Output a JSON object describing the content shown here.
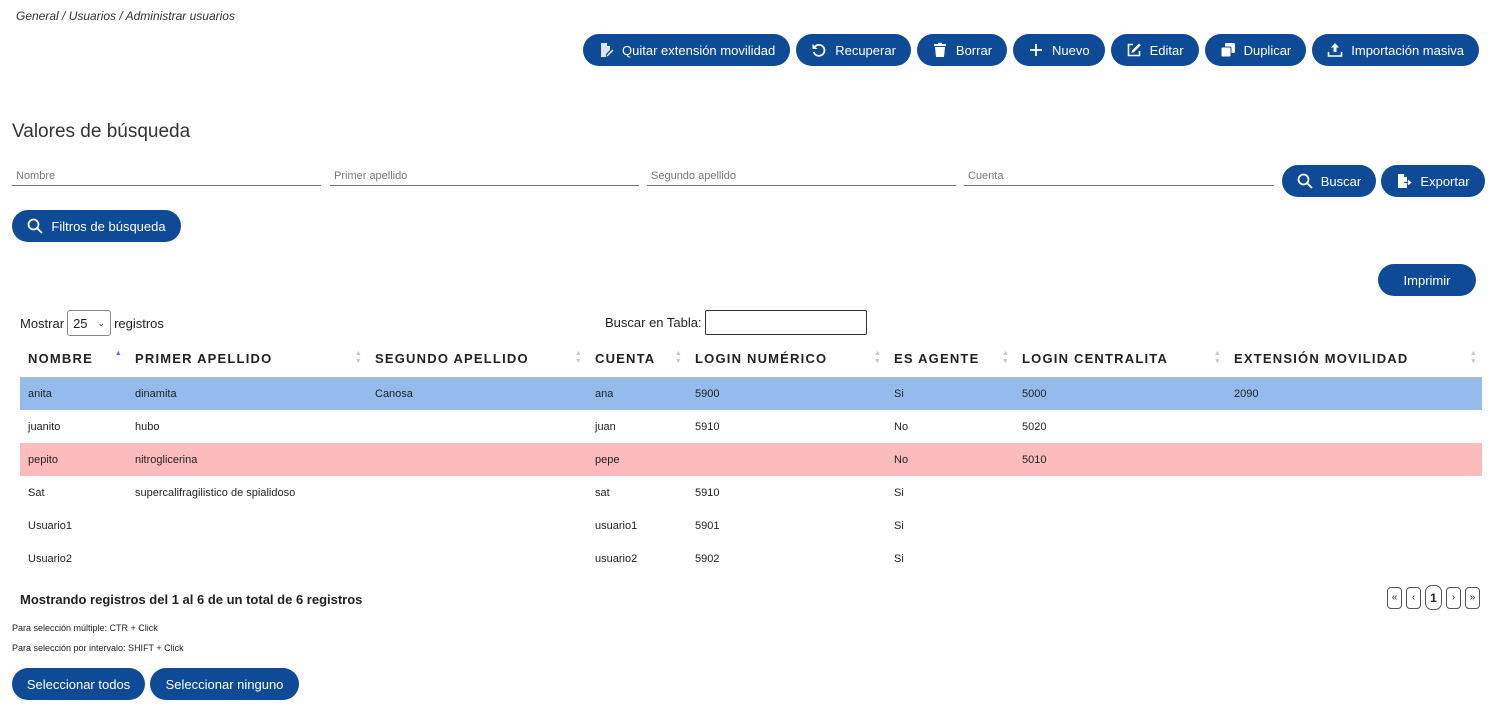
{
  "breadcrumb": "General / Usuarios / Administrar usuarios",
  "toolbar": {
    "quitar": "Quitar extensión movilidad",
    "recuperar": "Recuperar",
    "borrar": "Borrar",
    "nuevo": "Nuevo",
    "editar": "Editar",
    "duplicar": "Duplicar",
    "importacion": "Importación masiva"
  },
  "search": {
    "title": "Valores de búsqueda",
    "nombre_placeholder": "Nombre",
    "apellido1_placeholder": "Primer apellido",
    "apellido2_placeholder": "Segundo apellido",
    "cuenta_placeholder": "Cuenta",
    "buscar": "Buscar",
    "exportar": "Exportar",
    "filtros": "Filtros de búsqueda"
  },
  "imprimir": "Imprimir",
  "table_controls": {
    "mostrar": "Mostrar",
    "page_size": "25",
    "registros": "registros",
    "buscar_en_tabla": "Buscar en Tabla:"
  },
  "table": {
    "columns": [
      "NOMBRE",
      "PRIMER APELLIDO",
      "SEGUNDO APELLIDO",
      "CUENTA",
      "LOGIN NUMÉRICO",
      "ES AGENTE",
      "LOGIN CENTRALITA",
      "EXTENSIÓN MOVILIDAD"
    ],
    "rows": [
      [
        "anita",
        "dinamita",
        "Canosa",
        "ana",
        "5900",
        "Si",
        "5000",
        "2090"
      ],
      [
        "juanito",
        "hubo",
        "",
        "juan",
        "5910",
        "No",
        "5020",
        ""
      ],
      [
        "pepito",
        "nitroglicerina",
        "",
        "pepe",
        "",
        "No",
        "5010",
        ""
      ],
      [
        "Sat",
        "supercalifragilistico de spialidoso",
        "",
        "sat",
        "5910",
        "Si",
        "",
        ""
      ],
      [
        "Usuario1",
        "",
        "",
        "usuario1",
        "5901",
        "Si",
        "",
        ""
      ],
      [
        "Usuario2",
        "",
        "",
        "usuario2",
        "5902",
        "Si",
        "",
        ""
      ]
    ]
  },
  "info": "Mostrando registros del 1 al 6 de un total de 6 registros",
  "hints": {
    "multiple": "Para selección múltiple: CTR + Click",
    "intervalo": "Para selección por intervalo: SHIFT + Click"
  },
  "pagination": {
    "first": "«",
    "prev": "‹",
    "current": "1",
    "next": "›",
    "last": "»"
  },
  "selection": {
    "todos": "Seleccionar todos",
    "ninguno": "Seleccionar ninguno"
  },
  "colors": {
    "primary": "#0f4a96",
    "row_selected": "#95bbec",
    "row_alert": "#fdbcbc"
  }
}
